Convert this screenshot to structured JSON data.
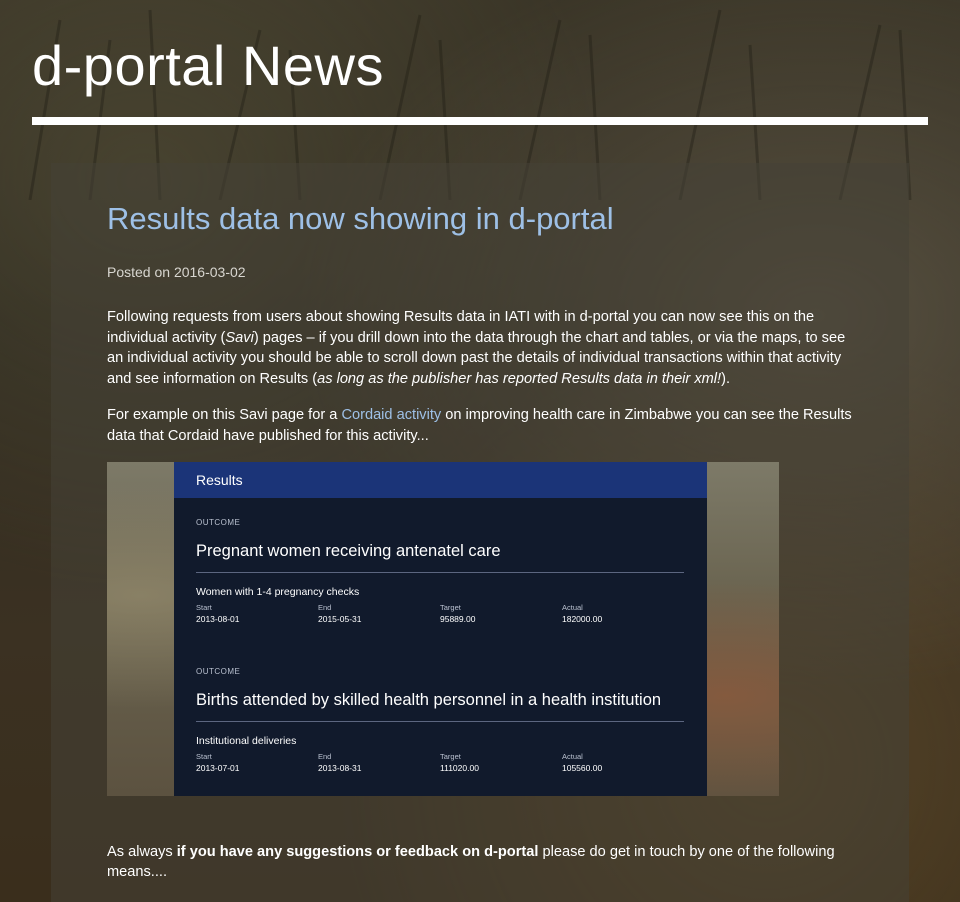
{
  "site": {
    "title": "d-portal News"
  },
  "post": {
    "title": "Results data now showing in d-portal",
    "posted_label": "Posted on",
    "posted_date": "2016-03-02",
    "p1": {
      "a": "Following requests from users about showing Results data in IATI with in d-portal you can now see this on the individual activity (",
      "savi": "Savi",
      "b": ") pages – if you drill down into the data through the chart and tables, or via the maps, to see an individual activity you should be able to scroll down past the details of individual transactions within that activity and see information on Results (",
      "note": "as long as the publisher has reported Results data in their xml!",
      "c": ")."
    },
    "p2": {
      "a": "For example on this Savi page for a ",
      "link": "Cordaid activity",
      "b": " on improving health care in Zimbabwe you can see the Results data that Cordaid have published for this activity..."
    },
    "closing": {
      "a": "As always ",
      "bold": "if you have any suggestions or feedback on d-portal",
      "b": " please do get in touch by one of the following means...."
    }
  },
  "results_image": {
    "header": "Results",
    "outcomes": [
      {
        "kicker": "OUTCOME",
        "title": "Pregnant women receiving antenatel care",
        "indicator": "Women with 1-4 pregnancy checks",
        "fields": [
          {
            "label": "Start",
            "value": "2013-08-01"
          },
          {
            "label": "End",
            "value": "2015-05-31"
          },
          {
            "label": "Target",
            "value": "95889.00"
          },
          {
            "label": "Actual",
            "value": "182000.00"
          }
        ]
      },
      {
        "kicker": "OUTCOME",
        "title": "Births attended by skilled health personnel in a health institution",
        "indicator": "Institutional deliveries",
        "fields": [
          {
            "label": "Start",
            "value": "2013-07-01"
          },
          {
            "label": "End",
            "value": "2013-08-31"
          },
          {
            "label": "Target",
            "value": "111020.00"
          },
          {
            "label": "Actual",
            "value": "105560.00"
          }
        ]
      }
    ]
  }
}
